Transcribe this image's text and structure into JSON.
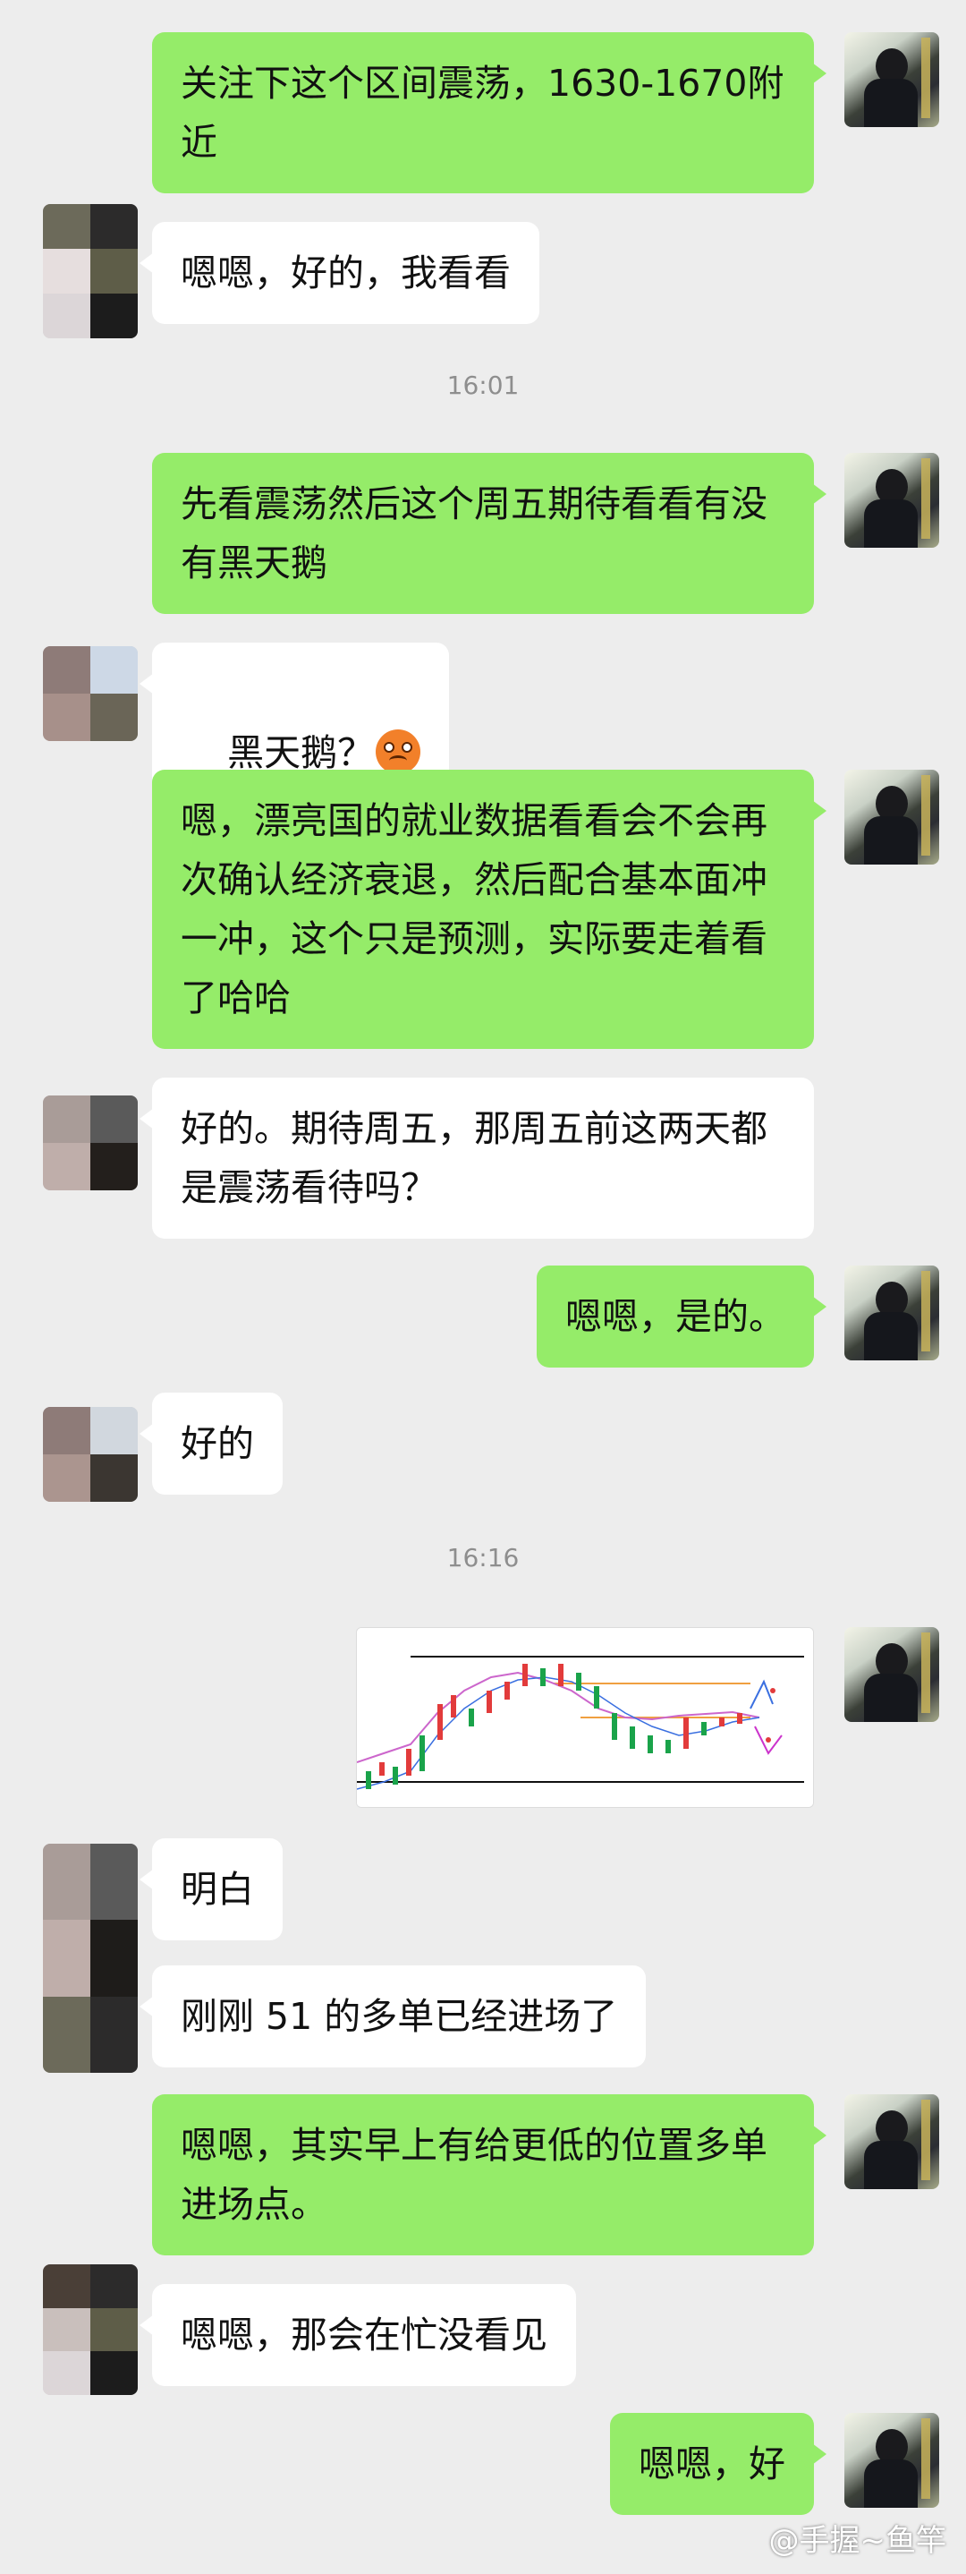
{
  "messages": [
    {
      "side": "me",
      "text": "关注下这个区间震荡，1630-1670附近"
    },
    {
      "side": "other",
      "text": "嗯嗯，好的，我看看"
    },
    {
      "type": "time",
      "text": "16:01"
    },
    {
      "side": "me",
      "text": "先看震荡然后这个周五期待看看有没有黑天鹅"
    },
    {
      "side": "other",
      "text": "黑天鹅？",
      "emoji": "worried-face-icon"
    },
    {
      "side": "me",
      "text": "嗯，漂亮国的就业数据看看会不会再次确认经济衰退，然后配合基本面冲一冲，这个只是预测，实际要走着看了哈哈"
    },
    {
      "side": "other",
      "text": "好的。期待周五，那周五前这两天都是震荡看待吗？"
    },
    {
      "side": "me",
      "text": "嗯嗯，是的。"
    },
    {
      "side": "other",
      "text": "好的"
    },
    {
      "type": "time",
      "text": "16:16"
    },
    {
      "side": "me",
      "type": "image",
      "text": "price-chart-image"
    },
    {
      "side": "other",
      "text": "明白"
    },
    {
      "side": "other",
      "text": "刚刚 51 的多单已经进场了"
    },
    {
      "side": "me",
      "text": "嗯嗯，其实早上有给更低的位置多单进场点。"
    },
    {
      "side": "other",
      "text": "嗯嗯，那会在忙没看见"
    },
    {
      "side": "me",
      "text": "嗯嗯，好"
    }
  ],
  "watermark": "@手握~鱼竿",
  "colors": {
    "background": "#ededed",
    "me_bubble": "#95ec69",
    "other_bubble": "#ffffff",
    "timestamp": "#8e8e8e"
  }
}
